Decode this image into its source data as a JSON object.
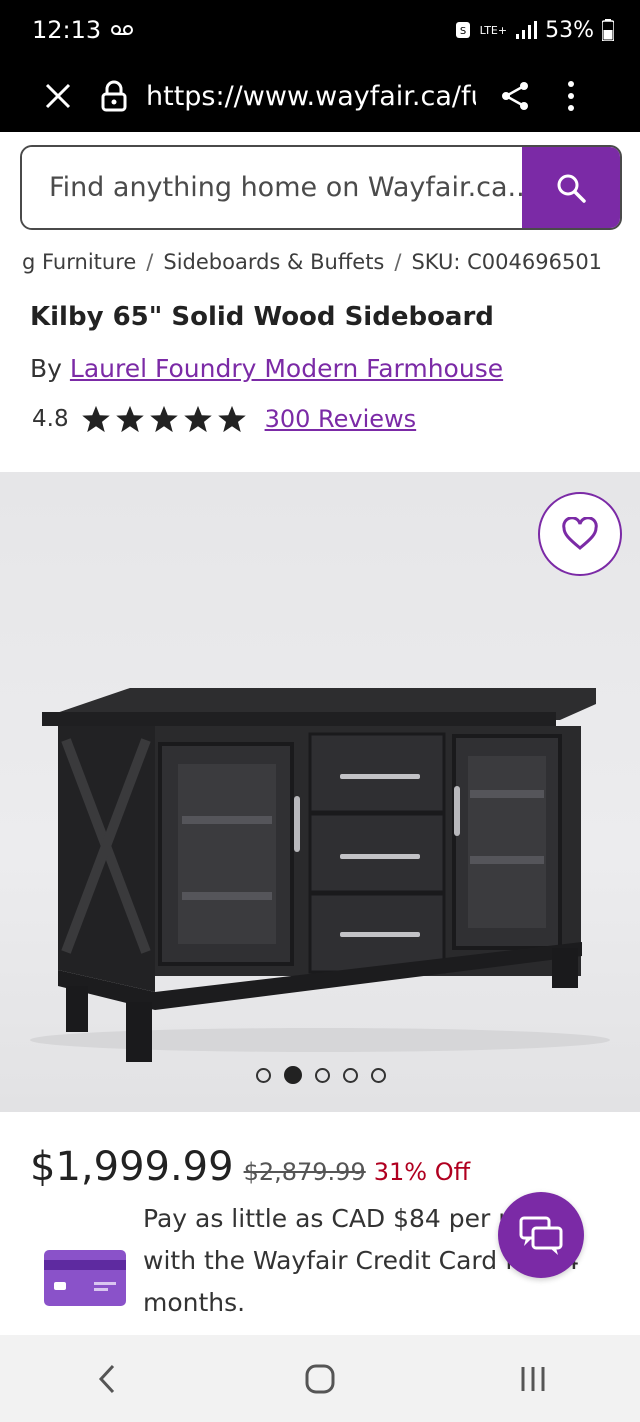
{
  "status_bar": {
    "time": "12:13",
    "network": "LTE+",
    "battery": "53%"
  },
  "browser": {
    "url": "https://www.wayfair.ca/fu"
  },
  "search": {
    "placeholder": "Find anything home on Wayfair.ca..."
  },
  "breadcrumb": [
    "g Furniture",
    "Sideboards & Buffets",
    "SKU: C004696501"
  ],
  "product": {
    "title": "Kilby 65\" Solid Wood Sideboard",
    "by_label": "By",
    "brand": "Laurel Foundry Modern Farmhouse",
    "rating": "4.8",
    "stars": 5,
    "reviews": "300 Reviews",
    "image_count": 5,
    "active_image": 2
  },
  "pricing": {
    "price": "$1,999.99",
    "old_price": "$2,879.99",
    "discount": "31% Off",
    "credit_line1": "Pay as little as CAD $84 per month",
    "credit_line2": "with the Wayfair Credit Card for 24",
    "credit_line3": "months."
  },
  "colors": {
    "accent": "#7b2aa6",
    "discount": "#b00020"
  }
}
